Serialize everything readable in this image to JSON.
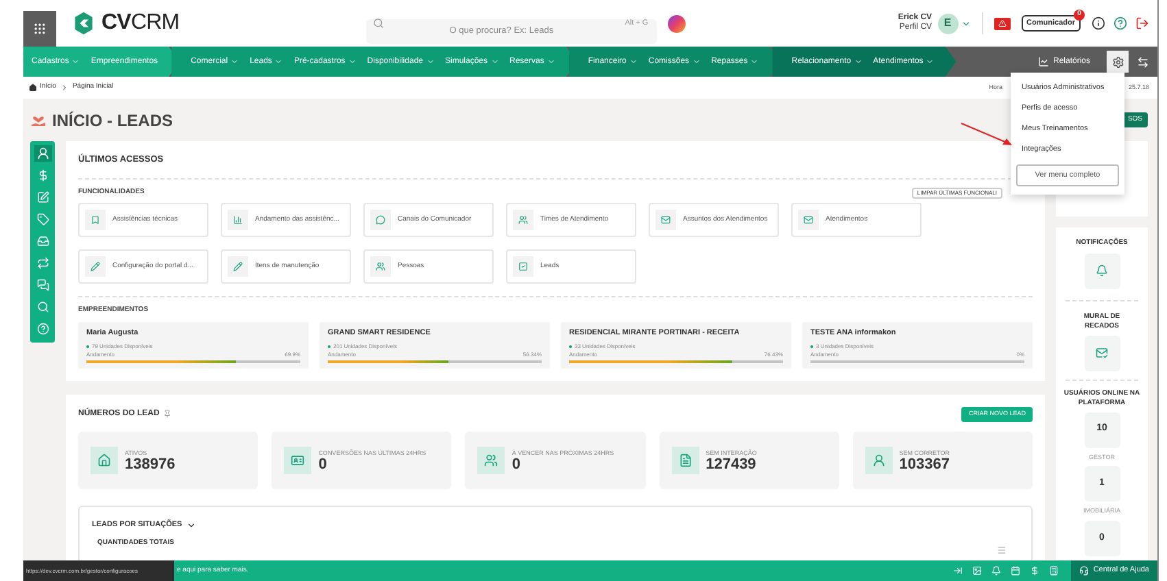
{
  "header": {
    "logo": "**CV**CRM",
    "search": {
      "placeholder": "O que procura? Ex: Leads",
      "shortcut": "Alt + G"
    },
    "user": {
      "name": "Erick CV",
      "profile": "Perfil CV",
      "initial": "E"
    },
    "communicator": {
      "label": "Comunicador",
      "badge": "0"
    }
  },
  "nav": {
    "groups": [
      {
        "color": "#17b386",
        "items": [
          "Cadastros",
          "Empreendimentos"
        ]
      },
      {
        "color": "#0e9c75",
        "items": [
          "Comercial",
          "Leads",
          "Pré-cadastros",
          "Disponibilidade",
          "Simulações",
          "Reservas"
        ]
      },
      {
        "color": "#0c8a67",
        "items": [
          "Financeiro",
          "Comissões",
          "Repasses"
        ]
      },
      {
        "color": "#09735a",
        "items": [
          "Relacionamento",
          "Atendimentos"
        ]
      }
    ],
    "dropdowns": [
      [
        true,
        false
      ],
      [
        true,
        true,
        true,
        true,
        true,
        true
      ],
      [
        true,
        true,
        true
      ],
      [
        true,
        true
      ]
    ],
    "reports": "Relatórios",
    "settings_open": true
  },
  "breadcrumb": [
    "Início",
    "Página Inicial"
  ],
  "version_label": "Hora",
  "version": "25.7.18",
  "settings_menu": {
    "items": [
      "Usuários Administrativos",
      "Perfis de acesso",
      "Meus Treinamentos",
      "Integrações"
    ],
    "button": "Ver menu completo"
  },
  "page": {
    "title": "INÍCIO - LEADS",
    "top_button": "SOS"
  },
  "recent": {
    "title": "ÚLTIMOS ACESSOS",
    "functions_title": "FUNCIONALIDADES",
    "clear_button": "LIMPAR ÚLTIMAS FUNCIONALI",
    "functions": [
      "Assistências técnicas",
      "Andamento das assistênc...",
      "Canais do Comunicador",
      "Times de Atendimento",
      "Assuntos dos Atendimentos",
      "Atendimentos",
      "Configuração do portal d...",
      "Itens de manutenção",
      "Pessoas",
      "Leads"
    ],
    "projects_title": "EMPREENDIMENTOS",
    "projects": [
      {
        "name": "Maria Augusta",
        "units": "79 Unidades Disponíveis",
        "progress_label": "Andamento",
        "percent": "69.9%",
        "level": 0.699
      },
      {
        "name": "GRAND SMART RESIDENCE",
        "units": "201 Unidades Disponíveis",
        "progress_label": "Andamento",
        "percent": "56.34%",
        "level": 0.5634
      },
      {
        "name": "RESIDENCIAL MIRANTE PORTINARI - RECEITA",
        "units": "33 Unidades Disponíveis",
        "progress_label": "Andamento",
        "percent": "76.43%",
        "level": 0.7643
      },
      {
        "name": "TESTE ANA informakon",
        "units": "3 Unidades Disponíveis",
        "progress_label": "Andamento",
        "percent": "0%",
        "level": 0
      }
    ]
  },
  "numbers": {
    "title": "NÚMEROS DO LEAD",
    "create_button": "CRIAR NOVO LEAD",
    "stats": [
      {
        "label": "ATIVOS",
        "value": "138976"
      },
      {
        "label": "CONVERSÕES NAS ÚLTIMAS 24HRS",
        "value": "0"
      },
      {
        "label": "À VENCER NAS PRÓXIMAS 24HRS",
        "value": "0"
      },
      {
        "label": "SEM INTERAÇÃO",
        "value": "127439"
      },
      {
        "label": "SEM CORRETOR",
        "value": "103367"
      }
    ],
    "situations_title": "LEADS POR SITUAÇÕES",
    "totals_title": "QUANTIDADES TOTAIS"
  },
  "right_panel": {
    "notifications": "NOTIFICAÇÕES",
    "mural": "MURAL DE RECADOS",
    "online_title": "USUÁRIOS ONLINE NA PLATAFORMA",
    "online": [
      {
        "value": "10",
        "label": "GESTOR"
      },
      {
        "value": "1",
        "label": "IMOBILIÁRIA"
      },
      {
        "value": "0"
      }
    ]
  },
  "footer": {
    "status_url": "https://dev.cvcrm.com.br/gestor/configuracoes",
    "message": "e aqui para saber mais.",
    "help": "Central de Ajuda"
  }
}
